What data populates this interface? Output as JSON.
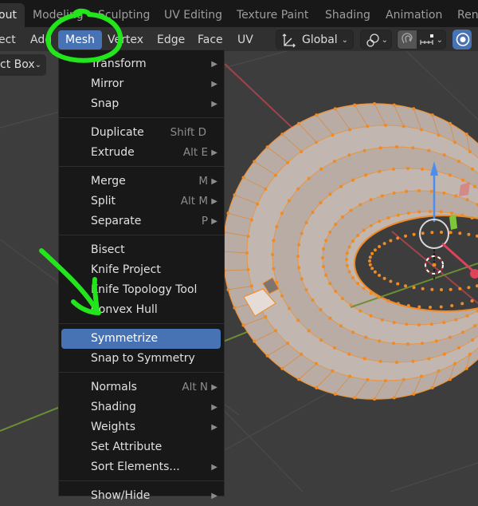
{
  "workspace_tabs": [
    {
      "label": "out",
      "active": true
    },
    {
      "label": "Modeling",
      "active": false
    },
    {
      "label": "Sculpting",
      "active": false
    },
    {
      "label": "UV Editing",
      "active": false
    },
    {
      "label": "Texture Paint",
      "active": false
    },
    {
      "label": "Shading",
      "active": false
    },
    {
      "label": "Animation",
      "active": false
    },
    {
      "label": "Ren",
      "active": false
    }
  ],
  "header_menus": [
    {
      "label": "ect",
      "active": false
    },
    {
      "label": "Add",
      "active": false
    },
    {
      "label": "Mesh",
      "active": true
    },
    {
      "label": "Vertex",
      "active": false
    },
    {
      "label": "Edge",
      "active": false
    },
    {
      "label": "Face",
      "active": false
    },
    {
      "label": "UV",
      "active": false
    }
  ],
  "header_tools": {
    "transform_orientation": "Global",
    "transform_orientation_icon": "orientation-axes-icon",
    "pivot_icon": "pivot-point-icon",
    "snap_icon": "magnet-icon",
    "snap_target_icon": "snap-increment-icon",
    "proportional_icon": "proportional-edit-icon"
  },
  "select_mode": "ct Box",
  "mesh_menu": {
    "groups": [
      [
        {
          "label": "Transform",
          "shortcut": "",
          "submenu": true
        },
        {
          "label": "Mirror",
          "shortcut": "",
          "submenu": true
        },
        {
          "label": "Snap",
          "shortcut": "",
          "submenu": true
        }
      ],
      [
        {
          "label": "Duplicate",
          "shortcut": "Shift D",
          "submenu": false
        },
        {
          "label": "Extrude",
          "shortcut": "Alt E",
          "submenu": true
        }
      ],
      [
        {
          "label": "Merge",
          "shortcut": "M",
          "submenu": true
        },
        {
          "label": "Split",
          "shortcut": "Alt M",
          "submenu": true
        },
        {
          "label": "Separate",
          "shortcut": "P",
          "submenu": true
        }
      ],
      [
        {
          "label": "Bisect",
          "shortcut": "",
          "submenu": false
        },
        {
          "label": "Knife Project",
          "shortcut": "",
          "submenu": false
        },
        {
          "label": "Knife Topology Tool",
          "shortcut": "",
          "submenu": false
        },
        {
          "label": "Convex Hull",
          "shortcut": "",
          "submenu": false
        }
      ],
      [
        {
          "label": "Symmetrize",
          "shortcut": "",
          "submenu": false,
          "highlighted": true
        },
        {
          "label": "Snap to Symmetry",
          "shortcut": "",
          "submenu": false
        }
      ],
      [
        {
          "label": "Normals",
          "shortcut": "Alt N",
          "submenu": true
        },
        {
          "label": "Shading",
          "shortcut": "",
          "submenu": true
        },
        {
          "label": "Weights",
          "shortcut": "",
          "submenu": true
        },
        {
          "label": "Set Attribute",
          "shortcut": "",
          "submenu": false
        },
        {
          "label": "Sort Elements...",
          "shortcut": "",
          "submenu": true
        }
      ],
      [
        {
          "label": "Show/Hide",
          "shortcut": "",
          "submenu": true
        }
      ]
    ]
  },
  "colors": {
    "accent": "#4772b3",
    "annotation": "#22e51c",
    "vertex": "#f08a24",
    "mesh": "#bfb2ab",
    "axis_x": "#a1424e",
    "axis_y": "#6b8f33",
    "gizmo_z": "#4a8ff0"
  }
}
